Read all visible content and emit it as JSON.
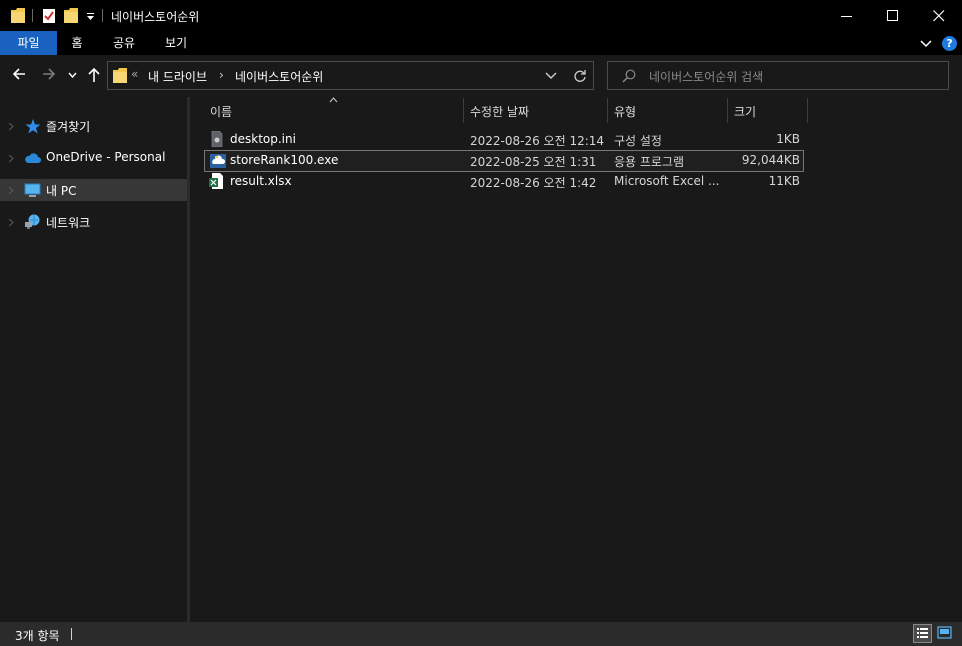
{
  "window": {
    "title": "네이버스토어순위",
    "minimize_label": "Minimize",
    "maximize_label": "Maximize",
    "close_label": "Close"
  },
  "ribbon": {
    "tabs": [
      {
        "label": "파일"
      },
      {
        "label": "홈"
      },
      {
        "label": "공유"
      },
      {
        "label": "보기"
      }
    ],
    "help_label": "?"
  },
  "address": {
    "overflow": "«",
    "segments": [
      "내 드라이브",
      "네이버스토어순위"
    ],
    "separator": "›"
  },
  "search": {
    "placeholder": "네이버스토어순위 검색"
  },
  "nav": {
    "items": [
      {
        "label": "즐겨찾기",
        "icon": "star-icon"
      },
      {
        "label": "OneDrive - Personal",
        "icon": "onedrive-cloud-icon"
      },
      {
        "label": "내 PC",
        "icon": "pc-icon",
        "selected": true
      },
      {
        "label": "네트워크",
        "icon": "network-icon"
      }
    ]
  },
  "columns": {
    "name": "이름",
    "date": "수정한 날짜",
    "type": "유형",
    "size": "크기"
  },
  "files": [
    {
      "name": "desktop.ini",
      "date": "2022-08-26 오전 12:14",
      "type": "구성 설정",
      "size": "1KB",
      "icon": "settings-file-icon"
    },
    {
      "name": "storeRank100.exe",
      "date": "2022-08-25 오전 1:31",
      "type": "응용 프로그램",
      "size": "92,044KB",
      "icon": "python-exe-icon",
      "selected": true
    },
    {
      "name": "result.xlsx",
      "date": "2022-08-26 오전 1:42",
      "type": "Microsoft Excel ...",
      "size": "11KB",
      "icon": "excel-file-icon"
    }
  ],
  "status": {
    "item_count": "3개 항목"
  },
  "colors": {
    "file_tab": "#1a62c0",
    "folder_yellow": "#f2c94c",
    "background": "#191919"
  }
}
